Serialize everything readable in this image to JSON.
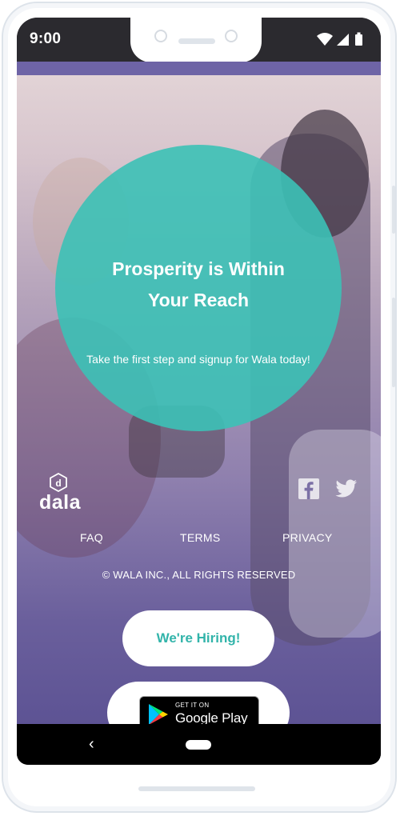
{
  "status_bar": {
    "time": "9:00",
    "icons": [
      "wifi-icon",
      "cellular-signal-icon",
      "battery-icon"
    ]
  },
  "hero": {
    "headline_line1": "Prosperity is Within",
    "headline_line2": "Your Reach",
    "subheadline": "Take the first step and signup for Wala today!"
  },
  "brand": {
    "logo_letter": "d",
    "wordmark": "dala"
  },
  "social": [
    "facebook-icon",
    "twitter-icon"
  ],
  "footer": {
    "links": [
      "FAQ",
      "TERMS",
      "PRIVACY"
    ],
    "copyright": "© WALA INC., ALL RIGHTS RESERVED"
  },
  "cta": {
    "hiring_label": "We're Hiring!",
    "store_small": "GET IT ON",
    "store_big": "Google Play"
  },
  "nav": {
    "back_glyph": "‹"
  },
  "colors": {
    "teal_circle": "#3cc1b6",
    "hiring_text": "#32b4aa",
    "purple_overlay": "#6a5f9c",
    "status_bar": "#2b2a2f",
    "nav_bar": "#000000"
  }
}
